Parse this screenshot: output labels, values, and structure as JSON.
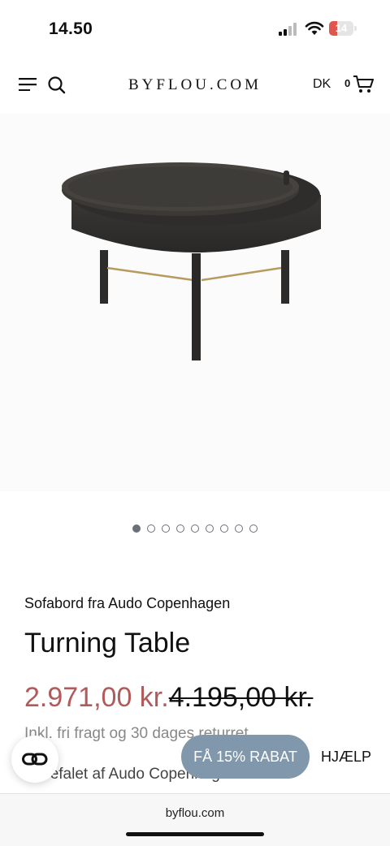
{
  "status_bar": {
    "time": "14.50",
    "battery": "14"
  },
  "header": {
    "logo": "BYFLOU.COM",
    "language": "DK",
    "cart_count": "0"
  },
  "carousel": {
    "total": 9,
    "active": 0
  },
  "product": {
    "subtitle": "Sofabord fra Audo Copenhagen",
    "name": "Turning Table",
    "sale_price": "2.971,00 kr.",
    "original_price": "4.195,00 kr.",
    "shipping_note": "Inkl. fri fragt og 30 dages returret",
    "recommendation": "anbefalet af Audo Copenhagen"
  },
  "floating": {
    "discount_label": "FÅ 15% RABAT",
    "help_label": "HJÆLP"
  },
  "browser": {
    "url": "byflou.com"
  }
}
